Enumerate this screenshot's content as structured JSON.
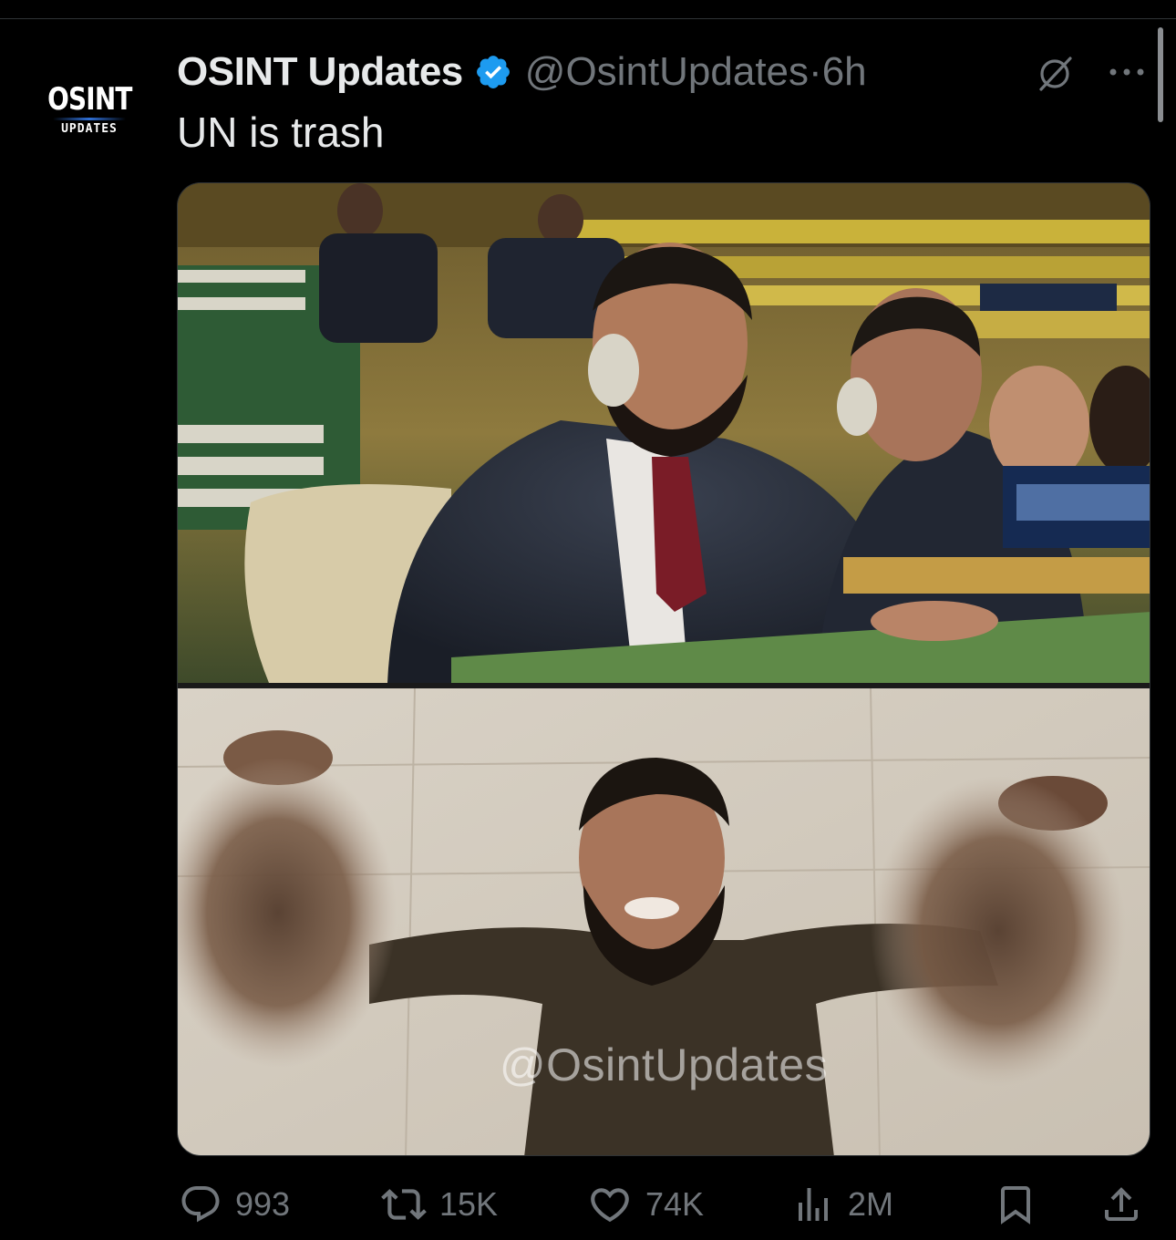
{
  "author": {
    "display_name": "OSINT Updates",
    "handle": "@OsintUpdates",
    "separator": "·",
    "time": "6h",
    "verified": true,
    "avatar_text_main": "OSINT",
    "avatar_text_sub": "UPDATES"
  },
  "tweet": {
    "text": "UN is trash",
    "media_watermark": "@OsintUpdates"
  },
  "actions": {
    "replies": "993",
    "reposts": "15K",
    "likes": "74K",
    "views": "2M"
  },
  "icons": {
    "verified": "verified-badge-icon",
    "grok": "grok-icon",
    "more": "more-icon",
    "reply": "reply-icon",
    "repost": "repost-icon",
    "like": "heart-icon",
    "views": "views-chart-icon",
    "bookmark": "bookmark-icon",
    "share": "share-icon"
  },
  "colors": {
    "background": "#000000",
    "text_primary": "#e7e9ea",
    "text_secondary": "#71767b",
    "verified_blue": "#1d9bf0"
  }
}
